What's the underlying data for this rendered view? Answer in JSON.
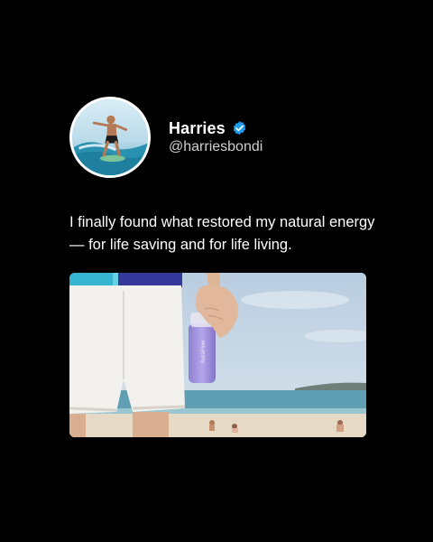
{
  "profile": {
    "display_name": "Harries",
    "handle": "@harriesbondi",
    "avatar_icon": "surfer-avatar",
    "verified_icon": "verified-badge-icon",
    "verified_color": "#1d9bf0"
  },
  "tweet": {
    "text": "I finally found what restored my natural energy — for life saving and for life living."
  },
  "media": {
    "description_icon": "beach-photo-with-drink-can"
  },
  "colors": {
    "background": "#000000",
    "text": "#ffffff",
    "handle": "#cfcfcf"
  }
}
